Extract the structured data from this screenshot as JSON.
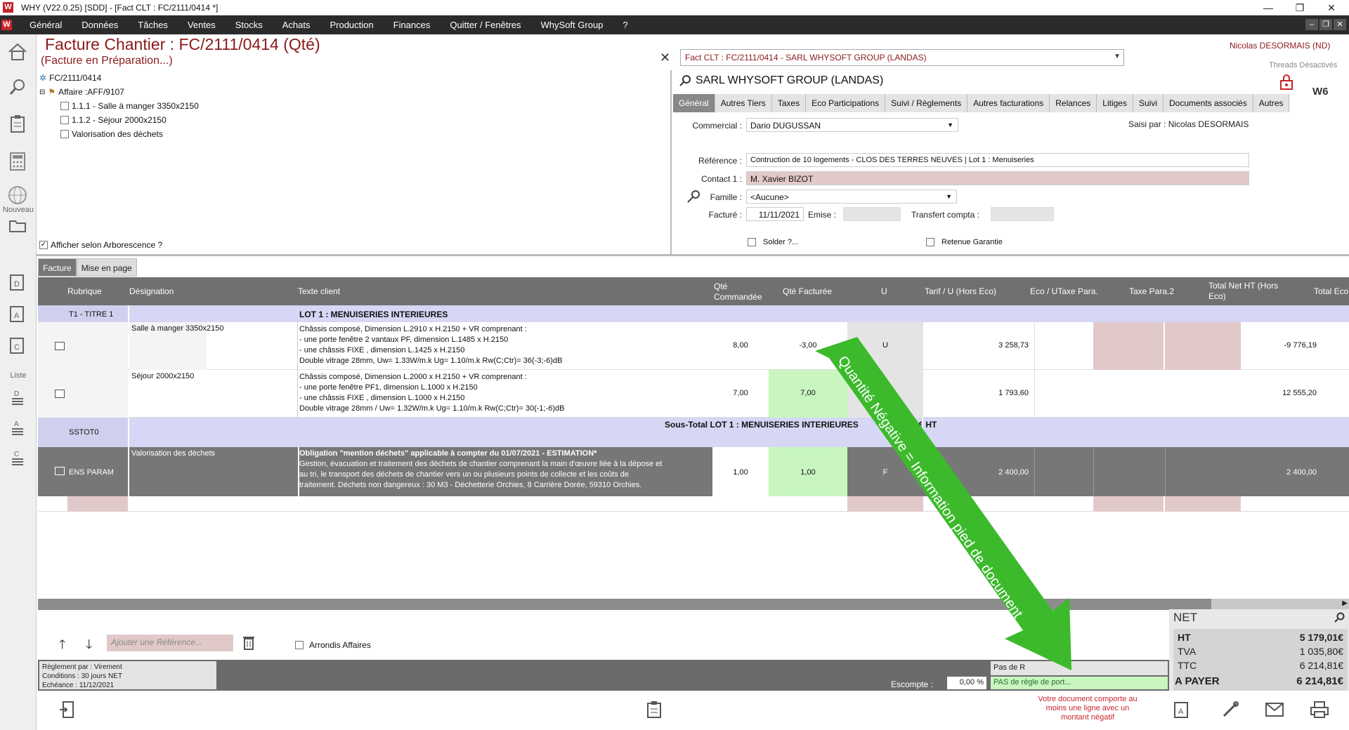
{
  "window": {
    "title": "WHY (V22.0.25)  [SDD] - [Fact CLT : FC/2111/0414 *]",
    "minimize": "—",
    "restore": "❐",
    "close": "✕"
  },
  "menu": {
    "items": [
      "Général",
      "Données",
      "Tâches",
      "Ventes",
      "Stocks",
      "Achats",
      "Production",
      "Finances",
      "Quitter / Fenêtres",
      "WhySoft Group",
      "?"
    ]
  },
  "leftbar": {
    "section_new": "Nouveau",
    "section_list": "Liste"
  },
  "header": {
    "title": "Facture Chantier : FC/2111/0414 (Qté)",
    "subtitle": "(Facture en Préparation...)",
    "client_select": "Fact CLT : FC/2111/0414 - SARL WHYSOFT GROUP  (LANDAS)",
    "user": "Nicolas DESORMAIS (ND)",
    "threads": "Threads Désactivés"
  },
  "tree": {
    "root": "FC/2111/0414",
    "affaire": "Affaire :AFF/9107",
    "items": [
      "1.1.1 - Salle à manger 3350x2150",
      "1.1.2 - Séjour 2000x2150",
      "Valorisation des déchets"
    ],
    "show_tree": "Afficher selon Arborescence ?"
  },
  "client": {
    "name": "SARL WHYSOFT GROUP  (LANDAS)",
    "logo": "W6"
  },
  "tabs": [
    "Général",
    "Autres Tiers",
    "Taxes",
    "Eco Participations",
    "Suivi / Règlements",
    "Autres facturations",
    "Relances",
    "Litiges",
    "Suivi",
    "Documents associés",
    "Autres"
  ],
  "form": {
    "commercial_label": "Commercial :",
    "commercial": "Dario DUGUSSAN",
    "saisi": "Saisi par : Nicolas DESORMAIS",
    "reference_label": "Référence :",
    "reference": "Contruction de 10 logements - CLOS DES TERRES NEUVES | Lot 1 : Menuiseries",
    "contact_label": "Contact 1 :",
    "contact": "M. Xavier BIZOT",
    "famille_label": "Famille :",
    "famille": "<Aucune>",
    "facture_label": "Facturé :",
    "facture": "11/11/2021",
    "emise_label": "Emise :",
    "transfert_label": "Transfert compta :",
    "solder": "Solder ?...",
    "retenue": "Retenue Garantie"
  },
  "bottomtabs": [
    "Facture",
    "Mise en page"
  ],
  "grid": {
    "headers": [
      "Rubrique",
      "Désignation",
      "Texte client",
      "Qté Commandée",
      "Qté Facturée",
      "U",
      "Tarif / U (Hors Eco)",
      "Eco / UTaxe Para.",
      "Taxe Para.2",
      "Total Net HT (Hors Eco)",
      "Total Eco"
    ],
    "title_rub": "T1 - TITRE 1",
    "title_txt": "LOT 1 : MENUISERIES INTERIEURES",
    "r1": {
      "des": "Salle à manger 3350x2150",
      "txt": [
        "Châssis composé, Dimension L.2910 x H.2150 + VR comprenant :",
        "- une porte fenêtre 2 vantaux PF, dimension L.1485 x H.2150",
        "- une châssis FIXE , dimension L.1425 x H.2150",
        "Double vitrage 28mm, Uw= 1.33W/m.k Ug= 1.10/m.k    Rw(C;Ctr)= 36(-3;-6)dB"
      ],
      "qc": "8,00",
      "qf": "-3,00",
      "u": "U",
      "tarif": "3 258,73",
      "total": "-9 776,19"
    },
    "r2": {
      "des": "Séjour 2000x2150",
      "txt": [
        "Châssis composé, Dimension L.2000 x H.2150 + VR comprenant :",
        "- une porte fenêtre PF1, dimension L.1000 x H.2150",
        "- une châssis FIXE , dimension L.1000 x H.2150",
        "Double vitrage 28mm / Uw= 1.32W/m.k  Ug= 1.10/m.k  Rw(C;Ctr)= 30(-1;-6)dB"
      ],
      "qc": "7,00",
      "qf": "7,00",
      "u": "U",
      "tarif": "1 793,60",
      "total": "12 555,20"
    },
    "sstot_rub": "SSTOT0",
    "sstot_txt": "Sous-Total LOT 1 : MENUISERIES INTERIEURES",
    "sstot_val": "0,01€ HT",
    "r3": {
      "rub": "ENS PARAM",
      "des": "Valorisation des déchets",
      "txt_bold": "Obligation \"mention déchets\" applicable à compter du 01/07/2021 - ESTIMATION*",
      "txt": [
        "Gestion, évacuation et traitement des déchets de chantier comprenant la main d'œuvre liée à la dépose et",
        "au tri, le transport des déchets de chantier vers un ou plusieurs points de collecte et les coûts de",
        "traitement. Déchets non dangereux : 30 M3 - Déchetterie Orchies, 8 Carrière Dorée, 59310 Orchies."
      ],
      "qc": "1,00",
      "qf": "1,00",
      "u": "F",
      "tarif": "2 400,00",
      "total": "2 400,00"
    }
  },
  "toolbar": {
    "ref_placeholder": "Ajouter une Référence...",
    "arrondis": "Arrondis Affaires"
  },
  "footer": {
    "reglement": "Règlement par : Virement",
    "conditions": "Conditions : 30 jours NET",
    "echeance": "Echéance : 11/12/2021",
    "escompte_label": "Escompte :",
    "escompte": "0,00 %",
    "port1": "Pas de R",
    "port2": "PAS de règle de        port...",
    "warning": "Votre document comporte au moins une ligne avec un montant négatif"
  },
  "totals": {
    "net": "NET",
    "ht_label": "HT",
    "ht": "5 179,01€",
    "tva_label": "TVA",
    "tva": "1 035,80€",
    "ttc_label": "TTC",
    "ttc": "6 214,81€",
    "pay_label": "A PAYER",
    "pay": "6 214,81€"
  },
  "annotation": {
    "text": "Quantité Négative = Information pied de document",
    "color": "#3cba2c"
  }
}
